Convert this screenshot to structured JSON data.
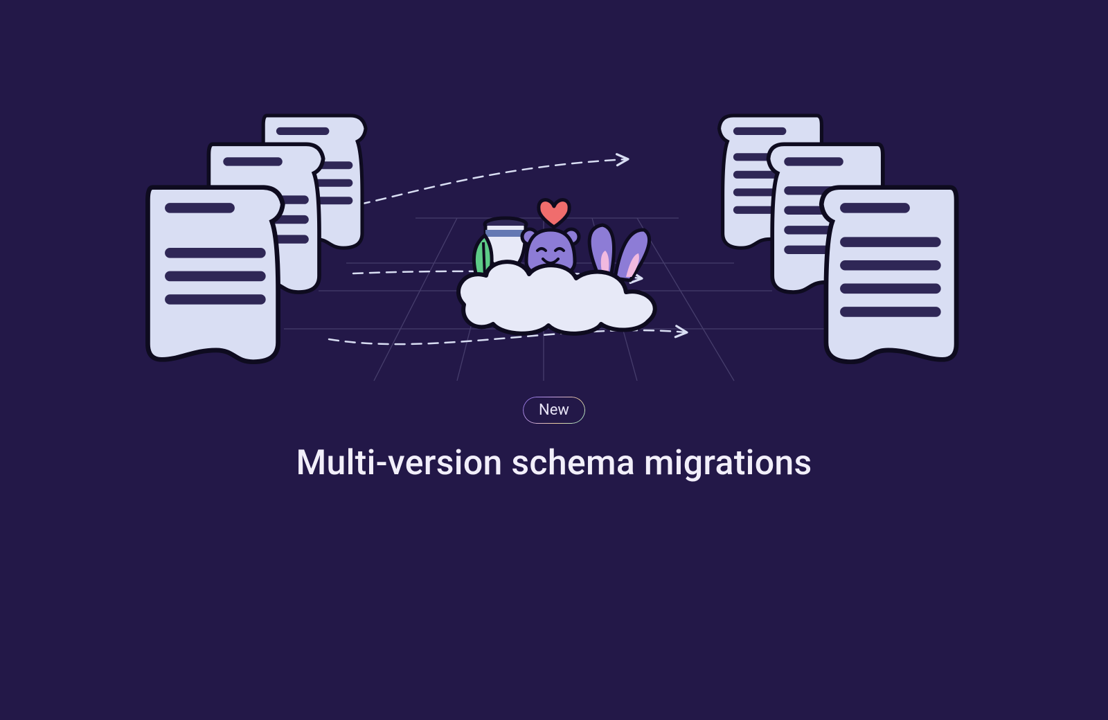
{
  "badge": {
    "label": "New"
  },
  "title": "Multi-version schema migrations",
  "colors": {
    "bg": "#231848",
    "docFill": "#D9DEF3",
    "docLine": "#2F2756",
    "cloud": "#E7E9F7",
    "mascot": "#8D7CD6",
    "heart": "#F06D6D",
    "leaf": "#5DCB87",
    "jarBody": "#E7E9F7",
    "jarLid": "#2F2756",
    "earOuter": "#8D7CD6",
    "earInner": "#F1B9DF"
  }
}
